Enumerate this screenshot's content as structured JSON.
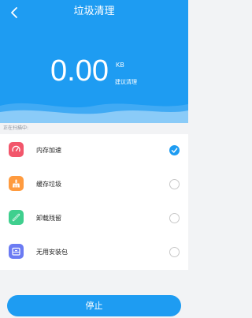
{
  "header": {
    "title": "垃圾清理",
    "back_icon": "chevron-left-icon"
  },
  "summary": {
    "value": "0.00",
    "unit": "KB",
    "suggestion": "建议清理"
  },
  "status_text": "正在扫描中:",
  "items": [
    {
      "label": "内存加速",
      "icon": "memory-speed-icon",
      "color": "#f2566b",
      "checked": true
    },
    {
      "label": "缓存垃圾",
      "icon": "broom-icon",
      "color": "#ff9b3f",
      "checked": false
    },
    {
      "label": "卸载残留",
      "icon": "uninstall-residue-icon",
      "color": "#3fcf8e",
      "checked": false
    },
    {
      "label": "无用安装包",
      "icon": "install-package-icon",
      "color": "#6b7bf3",
      "checked": false
    }
  ],
  "stop_label": "停止",
  "colors": {
    "primary": "#1e9cf2",
    "background": "#f2f3f5"
  }
}
